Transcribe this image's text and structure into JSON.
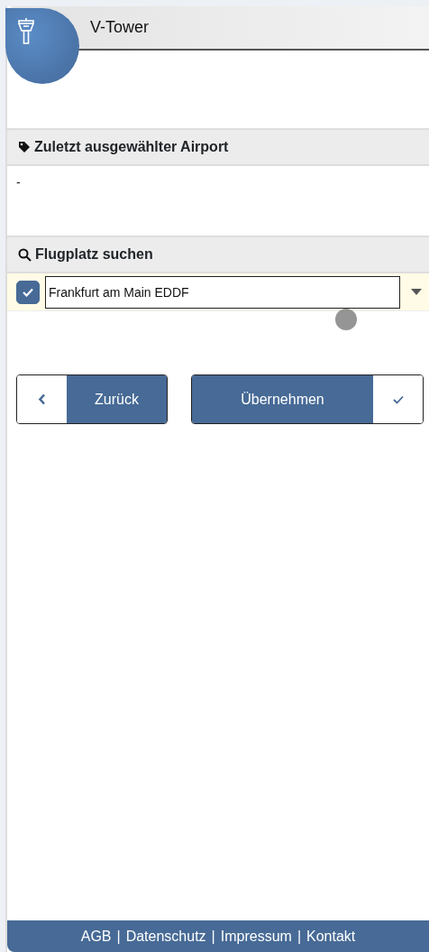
{
  "header": {
    "title": "V-Tower"
  },
  "last_airport": {
    "heading": "Zuletzt ausgewählter Airport",
    "value": "-"
  },
  "search": {
    "heading": "Flugplatz suchen",
    "checked": true,
    "value": "Frankfurt am Main EDDF"
  },
  "buttons": [
    {
      "kind": "back",
      "label": "Zurück"
    },
    {
      "kind": "apply",
      "label": "Übernehmen"
    }
  ],
  "footer": {
    "links": [
      "AGB",
      "Datenschutz",
      "Impressum",
      "Kontakt"
    ],
    "separator": "|"
  }
}
